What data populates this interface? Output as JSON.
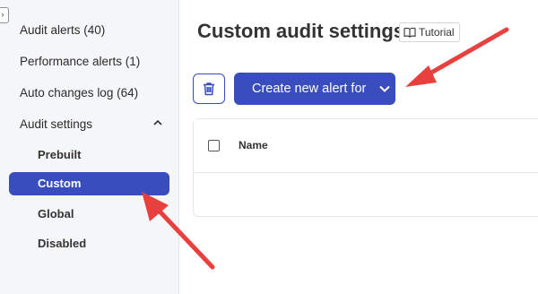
{
  "sidebar": {
    "items": [
      {
        "label": "Audit alerts (40)"
      },
      {
        "label": "Performance alerts (1)"
      },
      {
        "label": "Auto changes log (64)"
      },
      {
        "label": "Audit settings"
      }
    ],
    "audit_settings_expanded": true,
    "sub_items": [
      {
        "label": "Prebuilt",
        "active": false
      },
      {
        "label": "Custom",
        "active": true
      },
      {
        "label": "Global",
        "active": false
      },
      {
        "label": "Disabled",
        "active": false
      }
    ]
  },
  "main": {
    "title": "Custom audit settings",
    "tutorial_label": "Tutorial",
    "create_button_label": "Create new alert for",
    "table": {
      "columns": [
        "Name"
      ],
      "rows": []
    }
  },
  "colors": {
    "accent": "#3a4dbf",
    "annotation_arrow": "#e8403f",
    "sidebar_bg": "#f5f6f8"
  },
  "icons": {
    "collapse": "chevron-right-icon",
    "expand": "chevron-up-icon",
    "tutorial": "book-icon",
    "delete": "trash-icon",
    "dropdown": "chevron-down-icon"
  }
}
